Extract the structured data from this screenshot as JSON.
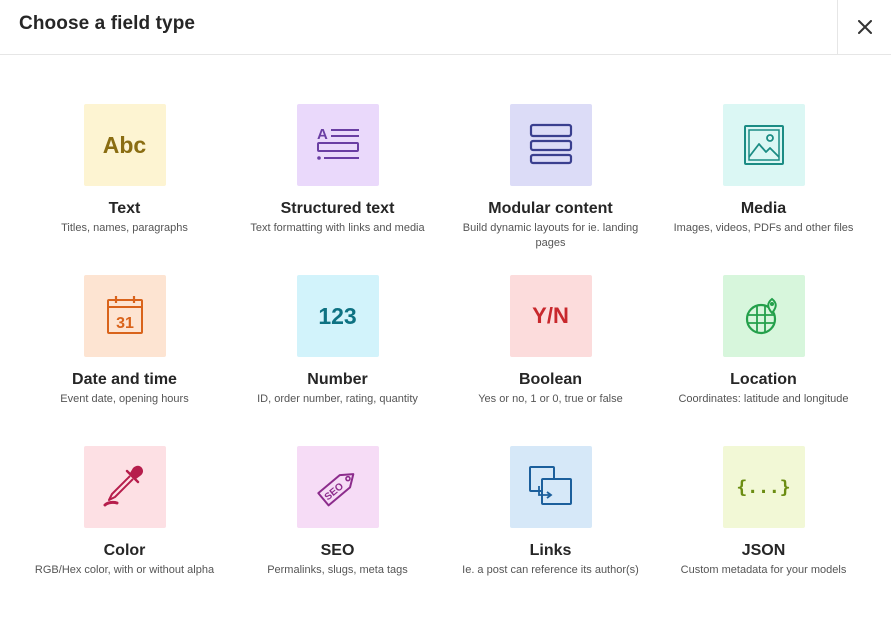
{
  "modal": {
    "title": "Choose a field type",
    "close_icon": "close-icon"
  },
  "field_types": [
    {
      "id": "text",
      "title": "Text",
      "description": "Titles, names, paragraphs",
      "tile_label": "Abc",
      "tile_color": "#fdf4d2",
      "icon_color": "#8a6d12",
      "icon": "abc-text-icon"
    },
    {
      "id": "structured-text",
      "title": "Structured text",
      "description": "Text formatting with links and media",
      "tile_color": "#ead9fb",
      "icon_color": "#6a3ea3",
      "icon": "structured-text-icon"
    },
    {
      "id": "modular-content",
      "title": "Modular content",
      "description": "Build dynamic layouts for ie. landing pages",
      "tile_color": "#dcdcf7",
      "icon_color": "#3a3f8f",
      "icon": "modular-blocks-icon"
    },
    {
      "id": "media",
      "title": "Media",
      "description": "Images, videos, PDFs and other files",
      "tile_color": "#dbf7f4",
      "icon_color": "#1b8c84",
      "icon": "image-icon"
    },
    {
      "id": "date-time",
      "title": "Date and time",
      "description": "Event date, opening hours",
      "tile_label": "31",
      "tile_color": "#fde4d2",
      "icon_color": "#d9631b",
      "icon": "calendar-icon"
    },
    {
      "id": "number",
      "title": "Number",
      "description": "ID, order number, rating, quantity",
      "tile_label": "123",
      "tile_color": "#d2f3fb",
      "icon_color": "#0e7282",
      "icon": "number-icon"
    },
    {
      "id": "boolean",
      "title": "Boolean",
      "description": "Yes or no, 1 or 0, true or false",
      "tile_label": "Y/N",
      "tile_color": "#fcdcdc",
      "icon_color": "#c8282d",
      "icon": "yes-no-icon"
    },
    {
      "id": "location",
      "title": "Location",
      "description": "Coordinates: latitude and longitude",
      "tile_color": "#d7f6dc",
      "icon_color": "#24a04b",
      "icon": "globe-pin-icon"
    },
    {
      "id": "color",
      "title": "Color",
      "description": "RGB/Hex color, with or without alpha",
      "tile_color": "#fde0e4",
      "icon_color": "#b61e4c",
      "icon": "eyedropper-icon"
    },
    {
      "id": "seo",
      "title": "SEO",
      "description": "Permalinks, slugs, meta tags",
      "tile_label": "SEO",
      "tile_color": "#f6dcf6",
      "icon_color": "#8c2c8c",
      "icon": "seo-tag-icon"
    },
    {
      "id": "links",
      "title": "Links",
      "description": "Ie. a post can reference its author(s)",
      "tile_color": "#d6e8f8",
      "icon_color": "#1c5f9c",
      "icon": "linked-windows-icon"
    },
    {
      "id": "json",
      "title": "JSON",
      "description": "Custom metadata for your models",
      "tile_label": "{...}",
      "tile_color": "#f2f8d6",
      "icon_color": "#6b8d12",
      "icon": "json-braces-icon"
    }
  ]
}
